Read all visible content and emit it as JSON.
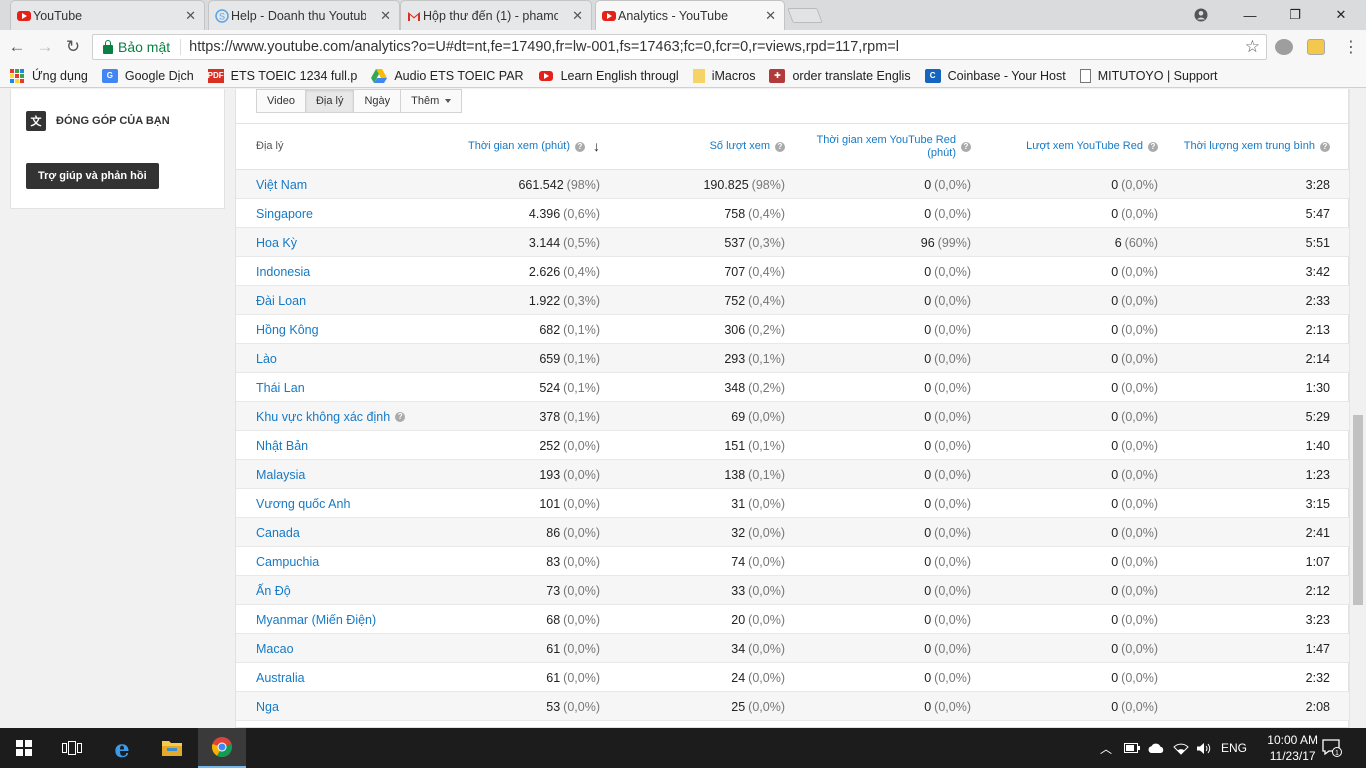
{
  "browser": {
    "tabs": [
      {
        "title": "YouTube",
        "icon": "youtube-icon"
      },
      {
        "title": "Help - Doanh thu Youtub",
        "icon": "help-icon"
      },
      {
        "title": "Hộp thư đến (1) - phamc",
        "icon": "gmail-icon"
      },
      {
        "title": "Analytics - YouTube",
        "icon": "youtube-icon"
      }
    ],
    "secure_label": "Bảo mật",
    "url": "https://www.youtube.com/analytics?o=U#dt=nt,fe=17490,fr=lw-001,fs=17463;fc=0,fcr=0,r=views,rpd=117,rpm=l",
    "bookmarks": [
      {
        "label": "Ứng dụng"
      },
      {
        "label": "Google Dịch"
      },
      {
        "label": "ETS TOEIC 1234 full.p"
      },
      {
        "label": "Audio ETS TOEIC PAR"
      },
      {
        "label": "Learn English througl"
      },
      {
        "label": "iMacros"
      },
      {
        "label": "order translate Englis"
      },
      {
        "label": "Coinbase - Your Host"
      },
      {
        "label": "MITUTOYO | Support"
      }
    ]
  },
  "sidebar": {
    "contribute": "ĐÓNG GÓP CỦA BẠN",
    "help_button": "Trợ giúp và phản hồi"
  },
  "report": {
    "tabs": [
      "Video",
      "Địa lý",
      "Ngày",
      "Thêm"
    ],
    "selected_tab": "Địa lý",
    "columns": {
      "geo": "Địa lý",
      "watch_time": "Thời gian xem (phút)",
      "views": "Số lượt xem",
      "red_watch_time": "Thời gian xem YouTube Red (phút)",
      "red_views": "Lượt xem YouTube Red",
      "avg_duration": "Thời lượng xem trung bình"
    },
    "rows": [
      {
        "geo": "Việt Nam",
        "watch": "661.542",
        "watch_pct": "(98%)",
        "views": "190.825",
        "views_pct": "(98%)",
        "red_watch": "0",
        "red_watch_pct": "(0,0%)",
        "red_views": "0",
        "red_views_pct": "(0,0%)",
        "avg": "3:28"
      },
      {
        "geo": "Singapore",
        "watch": "4.396",
        "watch_pct": "(0,6%)",
        "views": "758",
        "views_pct": "(0,4%)",
        "red_watch": "0",
        "red_watch_pct": "(0,0%)",
        "red_views": "0",
        "red_views_pct": "(0,0%)",
        "avg": "5:47"
      },
      {
        "geo": "Hoa Kỳ",
        "watch": "3.144",
        "watch_pct": "(0,5%)",
        "views": "537",
        "views_pct": "(0,3%)",
        "red_watch": "96",
        "red_watch_pct": "(99%)",
        "red_views": "6",
        "red_views_pct": "(60%)",
        "avg": "5:51"
      },
      {
        "geo": "Indonesia",
        "watch": "2.626",
        "watch_pct": "(0,4%)",
        "views": "707",
        "views_pct": "(0,4%)",
        "red_watch": "0",
        "red_watch_pct": "(0,0%)",
        "red_views": "0",
        "red_views_pct": "(0,0%)",
        "avg": "3:42"
      },
      {
        "geo": "Đài Loan",
        "watch": "1.922",
        "watch_pct": "(0,3%)",
        "views": "752",
        "views_pct": "(0,4%)",
        "red_watch": "0",
        "red_watch_pct": "(0,0%)",
        "red_views": "0",
        "red_views_pct": "(0,0%)",
        "avg": "2:33"
      },
      {
        "geo": "Hồng Kông",
        "watch": "682",
        "watch_pct": "(0,1%)",
        "views": "306",
        "views_pct": "(0,2%)",
        "red_watch": "0",
        "red_watch_pct": "(0,0%)",
        "red_views": "0",
        "red_views_pct": "(0,0%)",
        "avg": "2:13"
      },
      {
        "geo": "Lào",
        "watch": "659",
        "watch_pct": "(0,1%)",
        "views": "293",
        "views_pct": "(0,1%)",
        "red_watch": "0",
        "red_watch_pct": "(0,0%)",
        "red_views": "0",
        "red_views_pct": "(0,0%)",
        "avg": "2:14"
      },
      {
        "geo": "Thái Lan",
        "watch": "524",
        "watch_pct": "(0,1%)",
        "views": "348",
        "views_pct": "(0,2%)",
        "red_watch": "0",
        "red_watch_pct": "(0,0%)",
        "red_views": "0",
        "red_views_pct": "(0,0%)",
        "avg": "1:30"
      },
      {
        "geo": "Khu vực không xác định",
        "help": true,
        "watch": "378",
        "watch_pct": "(0,1%)",
        "views": "69",
        "views_pct": "(0,0%)",
        "red_watch": "0",
        "red_watch_pct": "(0,0%)",
        "red_views": "0",
        "red_views_pct": "(0,0%)",
        "avg": "5:29"
      },
      {
        "geo": "Nhật Bản",
        "watch": "252",
        "watch_pct": "(0,0%)",
        "views": "151",
        "views_pct": "(0,1%)",
        "red_watch": "0",
        "red_watch_pct": "(0,0%)",
        "red_views": "0",
        "red_views_pct": "(0,0%)",
        "avg": "1:40"
      },
      {
        "geo": "Malaysia",
        "watch": "193",
        "watch_pct": "(0,0%)",
        "views": "138",
        "views_pct": "(0,1%)",
        "red_watch": "0",
        "red_watch_pct": "(0,0%)",
        "red_views": "0",
        "red_views_pct": "(0,0%)",
        "avg": "1:23"
      },
      {
        "geo": "Vương quốc Anh",
        "watch": "101",
        "watch_pct": "(0,0%)",
        "views": "31",
        "views_pct": "(0,0%)",
        "red_watch": "0",
        "red_watch_pct": "(0,0%)",
        "red_views": "0",
        "red_views_pct": "(0,0%)",
        "avg": "3:15"
      },
      {
        "geo": "Canada",
        "watch": "86",
        "watch_pct": "(0,0%)",
        "views": "32",
        "views_pct": "(0,0%)",
        "red_watch": "0",
        "red_watch_pct": "(0,0%)",
        "red_views": "0",
        "red_views_pct": "(0,0%)",
        "avg": "2:41"
      },
      {
        "geo": "Campuchia",
        "watch": "83",
        "watch_pct": "(0,0%)",
        "views": "74",
        "views_pct": "(0,0%)",
        "red_watch": "0",
        "red_watch_pct": "(0,0%)",
        "red_views": "0",
        "red_views_pct": "(0,0%)",
        "avg": "1:07"
      },
      {
        "geo": "Ấn Độ",
        "watch": "73",
        "watch_pct": "(0,0%)",
        "views": "33",
        "views_pct": "(0,0%)",
        "red_watch": "0",
        "red_watch_pct": "(0,0%)",
        "red_views": "0",
        "red_views_pct": "(0,0%)",
        "avg": "2:12"
      },
      {
        "geo": "Myanmar (Miến Điện)",
        "watch": "68",
        "watch_pct": "(0,0%)",
        "views": "20",
        "views_pct": "(0,0%)",
        "red_watch": "0",
        "red_watch_pct": "(0,0%)",
        "red_views": "0",
        "red_views_pct": "(0,0%)",
        "avg": "3:23"
      },
      {
        "geo": "Macao",
        "watch": "61",
        "watch_pct": "(0,0%)",
        "views": "34",
        "views_pct": "(0,0%)",
        "red_watch": "0",
        "red_watch_pct": "(0,0%)",
        "red_views": "0",
        "red_views_pct": "(0,0%)",
        "avg": "1:47"
      },
      {
        "geo": "Australia",
        "watch": "61",
        "watch_pct": "(0,0%)",
        "views": "24",
        "views_pct": "(0,0%)",
        "red_watch": "0",
        "red_watch_pct": "(0,0%)",
        "red_views": "0",
        "red_views_pct": "(0,0%)",
        "avg": "2:32"
      },
      {
        "geo": "Nga",
        "watch": "53",
        "watch_pct": "(0,0%)",
        "views": "25",
        "views_pct": "(0,0%)",
        "red_watch": "0",
        "red_watch_pct": "(0,0%)",
        "red_views": "0",
        "red_views_pct": "(0,0%)",
        "avg": "2:08"
      }
    ]
  },
  "taskbar": {
    "language": "ENG",
    "time": "10:00 AM",
    "date": "11/23/17",
    "notification_count": "1"
  },
  "colors": {
    "link": "#167ac6",
    "youtube_red": "#e62117",
    "secure_green": "#0b8043"
  }
}
